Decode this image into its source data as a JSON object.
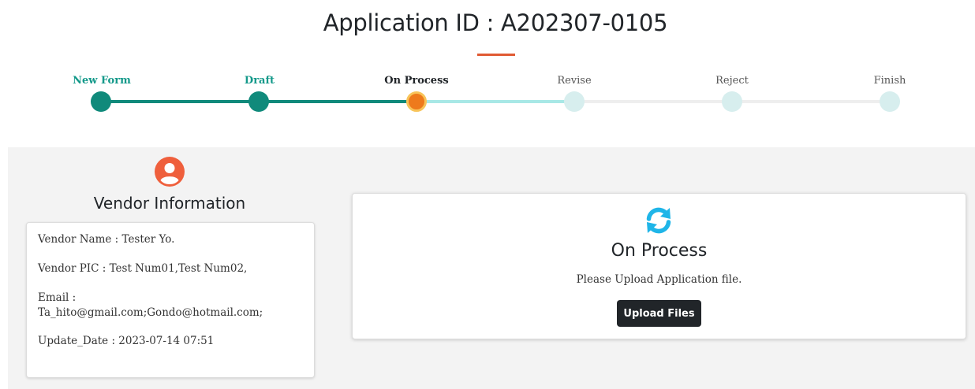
{
  "header": {
    "title": "Application ID : A202307-0105",
    "accent_color": "#e05a33"
  },
  "stepper": {
    "steps": [
      {
        "label": "New Form",
        "state": "done"
      },
      {
        "label": "Draft",
        "state": "done"
      },
      {
        "label": "On Process",
        "state": "current"
      },
      {
        "label": "Revise",
        "state": "todo"
      },
      {
        "label": "Reject",
        "state": "todo"
      },
      {
        "label": "Finish",
        "state": "todo"
      }
    ],
    "colors": {
      "done": "#108a7b",
      "current": "#ee7a1c",
      "todo": "#d7eeee"
    }
  },
  "vendor": {
    "icon": "user-circle-icon",
    "heading": "Vendor Information",
    "name_line": "Vendor Name : Tester Yo.",
    "pic_line": "Vendor PIC : Test Num01,Test Num02,",
    "email_label": "Email :",
    "email_value": "Ta_hito@gmail.com;Gondo@hotmail.com;",
    "update_line": "Update_Date : 2023-07-14 07:51"
  },
  "status": {
    "icon": "refresh-icon",
    "title": "On Process",
    "message": "Please Upload Application file.",
    "upload_button": "Upload Files"
  }
}
